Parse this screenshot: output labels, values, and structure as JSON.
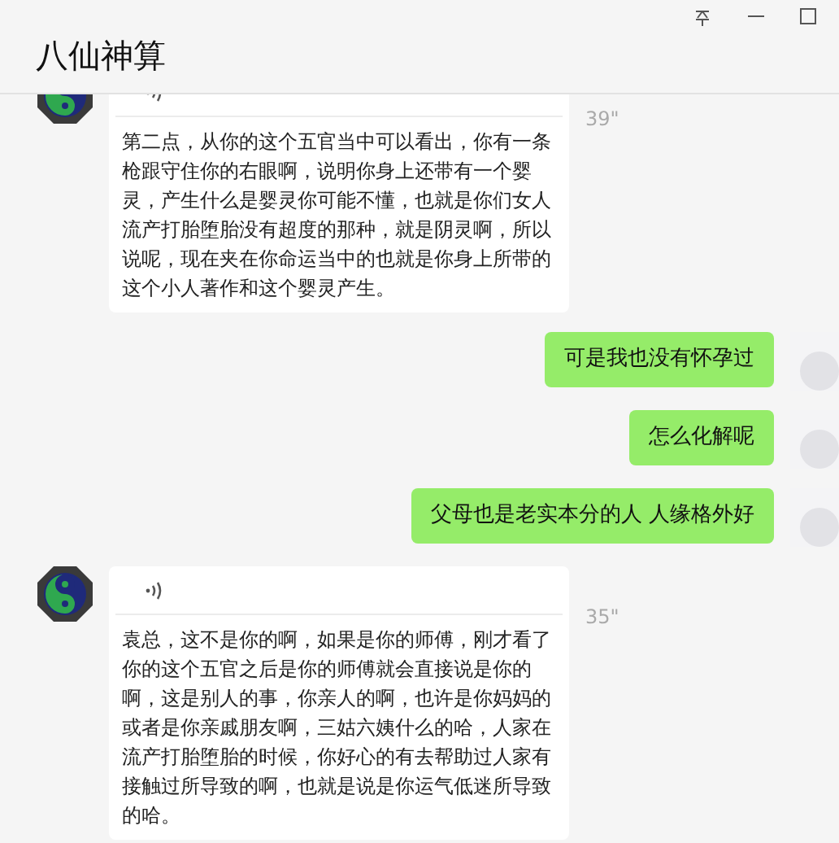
{
  "window": {
    "title": "八仙神算"
  },
  "messages": [
    {
      "kind": "voice",
      "duration": "39\"",
      "transcript": "第二点，从你的这个五官当中可以看出，你有一条枪跟守住你的右眼啊，说明你身上还带有一个婴灵，产生什么是婴灵你可能不懂，也就是你们女人流产打胎堕胎没有超度的那种，就是阴灵啊，所以说呢，现在夹在你命运当中的也就是你身上所带的这个小人著作和这个婴灵产生。"
    },
    {
      "kind": "text",
      "text": "可是我也没有怀孕过"
    },
    {
      "kind": "text",
      "text": "怎么化解呢"
    },
    {
      "kind": "text",
      "text": "父母也是老实本分的人 人缘格外好"
    },
    {
      "kind": "voice",
      "duration": "35\"",
      "transcript": "袁总，这不是你的啊，如果是你的师傅，刚才看了你的这个五官之后是你的师傅就会直接说是你的啊，这是别人的事，你亲人的啊，也许是你妈妈的或者是你亲戚朋友啊，三姑六姨什么的哈，人家在流产打胎堕胎的时候，你好心的有去帮助过人家有接触过所导致的啊，也就是说是你运气低迷所导致的哈。"
    }
  ]
}
